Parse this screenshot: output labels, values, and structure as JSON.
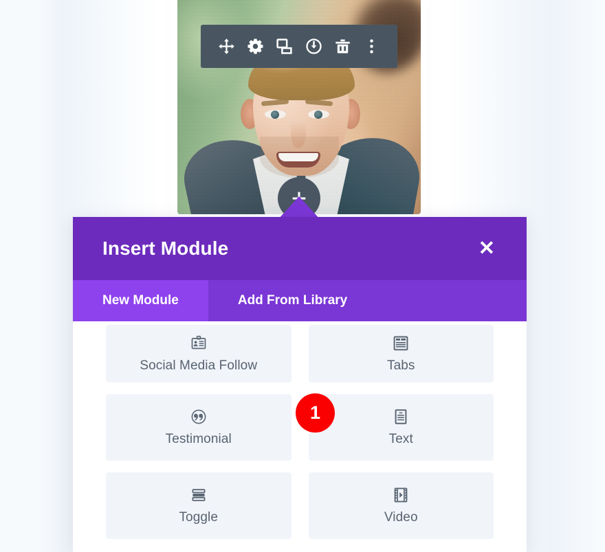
{
  "module_toolbar": {
    "name": "module-settings-toolbar",
    "background": "#495661",
    "buttons": [
      {
        "icon": "move-icon",
        "label": "Move Module"
      },
      {
        "icon": "gear-icon",
        "label": "Module Settings"
      },
      {
        "icon": "duplicate-icon",
        "label": "Duplicate Module"
      },
      {
        "icon": "save-to-library-icon",
        "label": "Save to Library"
      },
      {
        "icon": "trash-icon",
        "label": "Delete Module"
      },
      {
        "icon": "more-options-icon",
        "label": "Other Options"
      }
    ]
  },
  "add_module_button": {
    "icon": "plus-icon",
    "label": "Add New Module",
    "background": "#4a5662"
  },
  "modal": {
    "title": "Insert Module",
    "close_label": "✕",
    "header_color": "#6C2BBC",
    "tabs_color": "#7B36D6",
    "active_tab_color": "#8E42EE",
    "tabs": [
      {
        "label": "New Module",
        "active": true
      },
      {
        "label": "Add From Library",
        "active": false
      }
    ],
    "modules": [
      {
        "label": "Social Media Follow",
        "icon": "id-card-icon"
      },
      {
        "label": "Tabs",
        "icon": "tabs-window-icon"
      },
      {
        "label": "Testimonial",
        "icon": "quote-circle-icon"
      },
      {
        "label": "Text",
        "icon": "document-text-icon"
      },
      {
        "label": "Toggle",
        "icon": "toggle-stack-icon"
      },
      {
        "label": "Video",
        "icon": "film-play-icon"
      }
    ]
  },
  "annotation": {
    "step_badge": "1",
    "badge_color": "#FB0000"
  },
  "photo": {
    "alt": "smiling man in a suit outdoors",
    "name": "person-photo"
  }
}
